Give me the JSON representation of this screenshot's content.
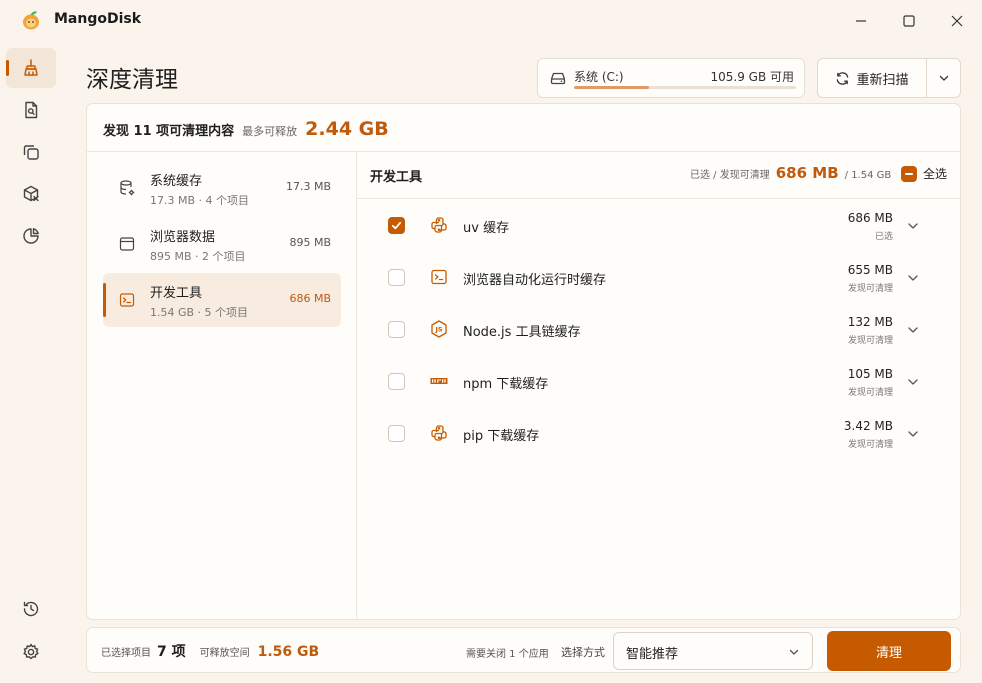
{
  "app": {
    "title": "MangoDisk",
    "accent": "#c65a00"
  },
  "window_controls": [
    "minimize-icon",
    "maximize-icon",
    "close-icon"
  ],
  "sidebar": {
    "top_items": [
      {
        "icon": "broom-icon",
        "active": true
      },
      {
        "icon": "file-search-icon",
        "active": false
      },
      {
        "icon": "duplicate-icon",
        "active": false
      },
      {
        "icon": "package-x-icon",
        "active": false
      },
      {
        "icon": "pie-chart-icon",
        "active": false
      }
    ],
    "bottom_items": [
      {
        "icon": "history-icon"
      },
      {
        "icon": "settings-icon"
      }
    ]
  },
  "page": {
    "title": "深度清理"
  },
  "drive": {
    "name": "系统 (C:)",
    "free": "105.9 GB 可用",
    "used_fraction": 0.34
  },
  "rescan": {
    "label": "重新扫描"
  },
  "summary": {
    "main": "发现 11 项可清理内容",
    "sub": "最多可释放",
    "size": "2.44 GB"
  },
  "categories": [
    {
      "name": "系统缓存",
      "meta": "17.3 MB · 4 个项目",
      "size": "17.3 MB",
      "icon": "database-gear-icon",
      "active": false
    },
    {
      "name": "浏览器数据",
      "meta": "895 MB · 2 个项目",
      "size": "895 MB",
      "icon": "browser-window-icon",
      "active": false
    },
    {
      "name": "开发工具",
      "meta": "1.54 GB · 5 个项目",
      "size": "686 MB",
      "icon": "terminal-icon",
      "active": true
    }
  ],
  "detail": {
    "title": "开发工具",
    "stats_label": "已选 / 发现可清理",
    "selected_size": "686 MB",
    "total": "/ 1.54 GB",
    "select_all": "全选",
    "items": [
      {
        "name": "uv 缓存",
        "size": "686 MB",
        "status": "已选",
        "checked": true,
        "icon": "python-icon"
      },
      {
        "name": "浏览器自动化运行时缓存",
        "size": "655 MB",
        "status": "发现可清理",
        "checked": false,
        "icon": "terminal-icon"
      },
      {
        "name": "Node.js 工具链缓存",
        "size": "132 MB",
        "status": "发现可清理",
        "checked": false,
        "icon": "nodejs-icon"
      },
      {
        "name": "npm 下载缓存",
        "size": "105 MB",
        "status": "发现可清理",
        "checked": false,
        "icon": "npm-icon"
      },
      {
        "name": "pip 下载缓存",
        "size": "3.42 MB",
        "status": "发现可清理",
        "checked": false,
        "icon": "python-icon"
      }
    ]
  },
  "footer": {
    "selected_label": "已选择项目",
    "selected_count": "7 项",
    "space_label": "可释放空间",
    "space_value": "1.56 GB",
    "close_note": "需要关闭 1 个应用",
    "mode_label": "选择方式",
    "mode_value": "智能推荐",
    "clean_label": "清理"
  }
}
